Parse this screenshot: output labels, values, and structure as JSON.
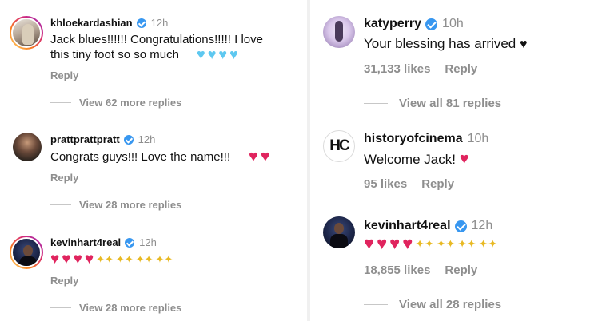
{
  "left_comments": [
    {
      "handle": "khloekardashian",
      "time": "12h",
      "text_lines": [
        "Jack blues!!!!!! Congratulations!!!!! I love",
        "this tiny foot so so much"
      ],
      "emoji": "light-blue-heart x4",
      "reply_label": "Reply",
      "view_label": "View 62 more replies"
    },
    {
      "handle": "prattprattpratt",
      "time": "12h",
      "text_lines": [
        "Congrats guys!!! Love the name!!!"
      ],
      "emoji": "red-heart x2",
      "reply_label": "Reply",
      "view_label": "View 28 more replies"
    },
    {
      "handle": "kevinhart4real",
      "time": "12h",
      "text_lines": [
        ""
      ],
      "emoji": "red-heart x4, raising-hands x4",
      "reply_label": "Reply",
      "view_label": "View 28 more replies"
    }
  ],
  "right_comments": [
    {
      "handle": "katyperry",
      "time": "10h",
      "text": "Your blessing has arrived",
      "emoji": "black-heart",
      "likes": "31,133 likes",
      "reply_label": "Reply",
      "view_label": "View all 81 replies"
    },
    {
      "handle": "historyofcinema",
      "time": "10h",
      "text": "Welcome Jack!",
      "emoji": "red-heart",
      "likes": "95 likes",
      "reply_label": "Reply",
      "avatar_text": "HC"
    },
    {
      "handle": "kevinhart4real",
      "time": "12h",
      "text": "",
      "emoji": "red-heart x4, raising-hands x4",
      "likes": "18,855 likes",
      "reply_label": "Reply",
      "view_label": "View all 28 replies"
    }
  ],
  "colors": {
    "verified": "#3897f0",
    "muted": "#8e8e8e",
    "red_heart": "#e0245e",
    "blue_heart": "#5ec8f0"
  }
}
